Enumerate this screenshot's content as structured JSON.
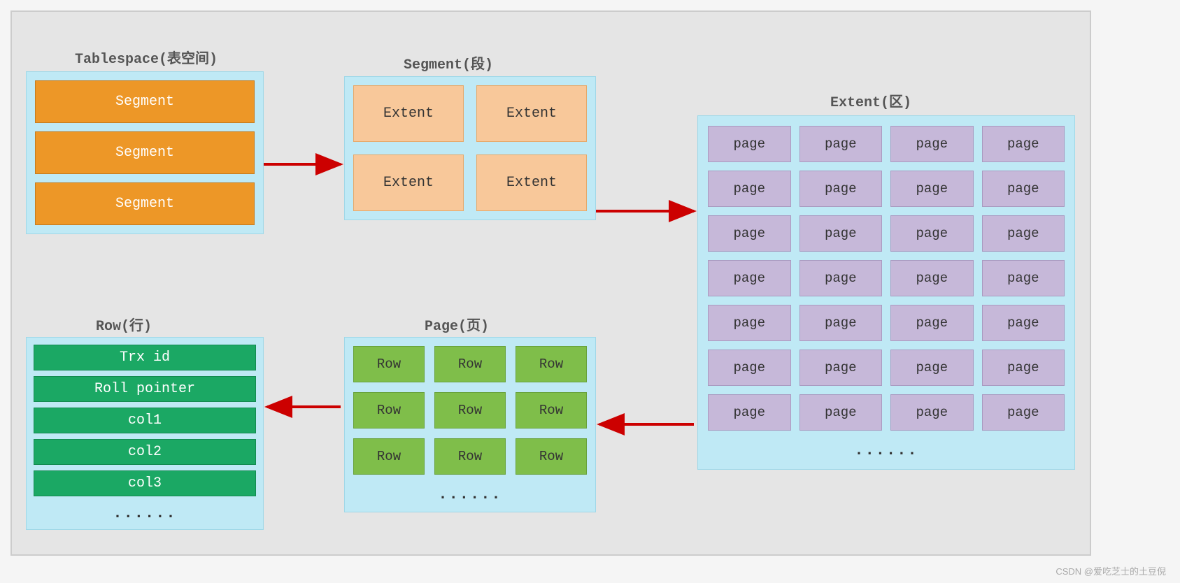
{
  "titles": {
    "tablespace": "Tablespace(表空间)",
    "segment": "Segment(段)",
    "extent": "Extent(区)",
    "page": "Page(页)",
    "row": "Row(行)"
  },
  "tablespace": {
    "items": [
      "Segment",
      "Segment",
      "Segment"
    ]
  },
  "segment": {
    "items": [
      "Extent",
      "Extent",
      "Extent",
      "Extent"
    ]
  },
  "extent": {
    "item_label": "page",
    "rows": 7,
    "cols": 4,
    "ellipsis": "......"
  },
  "page": {
    "items": [
      "Row",
      "Row",
      "Row",
      "Row",
      "Row",
      "Row",
      "Row",
      "Row",
      "Row"
    ],
    "ellipsis": "......"
  },
  "row": {
    "fields": [
      "Trx id",
      "Roll pointer",
      "col1",
      "col2",
      "col3"
    ],
    "ellipsis": "......"
  },
  "watermark": "CSDN @爱吃芝士的土豆倪"
}
